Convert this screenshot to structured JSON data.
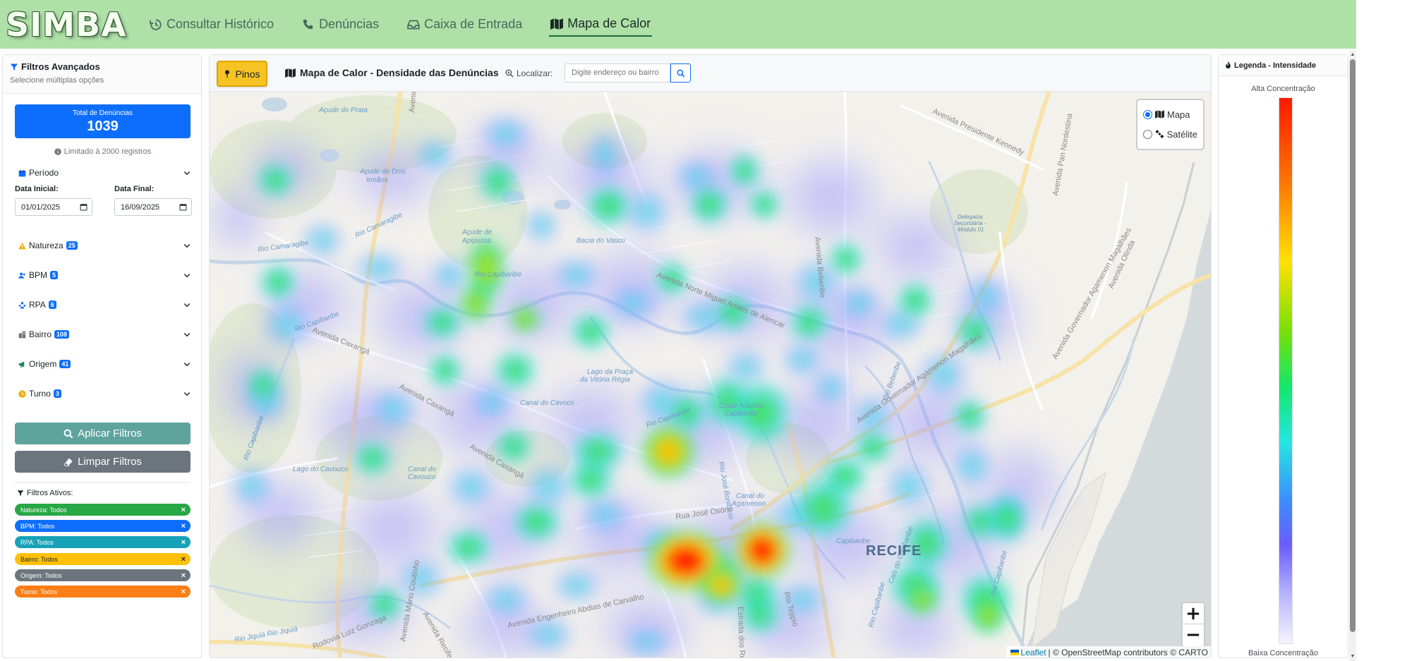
{
  "app": {
    "logo": "SIMBA"
  },
  "nav": {
    "items": [
      {
        "label": "Consultar Histórico",
        "icon": "history-icon"
      },
      {
        "label": "Denúncias",
        "icon": "phone-icon"
      },
      {
        "label": "Caixa de Entrada",
        "icon": "inbox-icon"
      },
      {
        "label": "Mapa de Calor",
        "icon": "map-icon",
        "active": true
      }
    ]
  },
  "sidebar": {
    "title": "Filtros Avançados",
    "subtitle": "Selecione múltiplas opções",
    "total_label": "Total de Denúncias",
    "total_value": "1039",
    "limit_note": "Limitado à 2000 registros",
    "period": {
      "label": "Período",
      "start_label": "Data Inicial:",
      "start_value": "01/01/2025",
      "end_label": "Data Final:",
      "end_value": "16/09/2025"
    },
    "filters": [
      {
        "label": "Natureza",
        "count": "25",
        "icon": "warning-icon",
        "icon_color": "#f0ad00"
      },
      {
        "label": "BPM",
        "count": "5",
        "icon": "users-icon",
        "icon_color": "#0d6efd"
      },
      {
        "label": "RPA",
        "count": "6",
        "icon": "region-icon",
        "icon_color": "#0d6efd"
      },
      {
        "label": "Bairro",
        "count": "108",
        "icon": "building-icon",
        "icon_color": "#6c757d"
      },
      {
        "label": "Origem",
        "count": "41",
        "icon": "megaphone-icon",
        "icon_color": "#198754"
      },
      {
        "label": "Turno",
        "count": "3",
        "icon": "clock-icon",
        "icon_color": "#f0ad00"
      }
    ],
    "apply_label": "Aplicar Filtros",
    "clear_label": "Limpar Filtros",
    "active_title": "Filtros Ativos:",
    "active_chips": [
      {
        "label": "Natureza: Todos",
        "color": "#28a745"
      },
      {
        "label": "BPM: Todos",
        "color": "#0d6efd"
      },
      {
        "label": "RPA: Todos",
        "color": "#17a2b8"
      },
      {
        "label": "Bairro: Todos",
        "color": "#ffc107"
      },
      {
        "label": "Origem: Todos",
        "color": "#6c757d"
      },
      {
        "label": "Turno: Todos",
        "color": "#fd7e14"
      }
    ]
  },
  "map": {
    "pins_label": "Pinos",
    "title": "Mapa de Calor - Densidade das Denúncias",
    "locate_label": "Localizar:",
    "search_placeholder": "Digite endereço ou bairro",
    "layers": [
      {
        "label": "Mapa",
        "selected": true
      },
      {
        "label": "Satélite",
        "selected": false
      }
    ],
    "zoom_in": "+",
    "zoom_out": "−",
    "attribution_leaflet": "Leaflet",
    "attribution_rest": "| © OpenStreetMap contributors © CARTO",
    "labels": {
      "city": "RECIFE",
      "acude_prata": "Açude do Prata",
      "acude_dois_irmaos": "Açude de Dois\nIrmãos",
      "acude_apipucos": "Açude de\nApipucos",
      "bacia_vasco": "Bacia do Vasco",
      "rio_camaragibe_1": "Rio Camaragibe",
      "rio_camaragibe_2": "Rio Camaragibe",
      "rio_capibaribe_1": "Rio Capibaribe",
      "rio_capibaribe_2": "Rio Capibaribe",
      "rio_capibaribe_3": "Rio Capibaribe",
      "rio_capibaribe_4": "Rio Capibaribe",
      "rio_jose_bonifacio": "Rio José Bonifácio",
      "rio_jiquia": "Rio Jiquiá Rio Jiquiá",
      "av_recuperacao": "Avenida da Recuperação",
      "av_norte": "Avenida Norte Miguel Arraes de Alencar",
      "av_caxanga_1": "Avenida Caxangá",
      "av_caxanga_2": "Avenida Caxangá",
      "av_caxanga_3": "Avenida Caxangá",
      "av_beberibe": "Avenida Beberibe",
      "av_kennedy": "Avenida Presidente Kennedy",
      "av_pan": "Avenida Pan Nordestina",
      "av_agamenon_1": "Avenida Governador Agamenon Magalhães",
      "av_agamenon_2": "Avenida Governador Agamenon Magalhães",
      "av_olinda": "Avenida Olinda",
      "av_abdias": "Avenida Engenheiro Abdias de Carvalho",
      "rua_jose_osorio": "Rua José Osório",
      "estrada_remedios": "Estrada dos Remédios",
      "av_recife": "Avenida Recife",
      "av_mario_coutinho": "Avenida Mário Coutinho",
      "rod_luiz_gonzaga": "Rodovia Luiz Gonzaga",
      "rio_tejipio": "Rio Tejipió",
      "rio_capibaribe_center": "Rio Capibaribe",
      "lago_praca": "Lago da Praça\nda Vitória Régia",
      "canal_cavoco": "Canal do Cavoco",
      "lago_cavouco": "Lago do Cavouco",
      "canal_cavouco": "Canal do\nCavouco",
      "clube_nautico": "Clube Náutico\nCapibaribe",
      "canal_agamenon": "Canal do\nAgamenon",
      "capibaribe_mouth": "Capibaribe",
      "rio_beberibe": "Rio Beberibe",
      "rio_capibaribe_east": "Rio Capibaribe",
      "rio_capibaribe_east2": "Rio Capibaribe",
      "cais_capibaribe": "Cais do Capibaribe",
      "delegacia": "Delegacia\nSecundária -\nMódulo 01"
    }
  },
  "legend": {
    "title": "Legenda - Intensidade",
    "high": "Alta Concentração",
    "low": "Baixa Concentração",
    "gradient": [
      "#ff1a00",
      "#ff7a00",
      "#ffe100",
      "#7fe000",
      "#12e86a",
      "#26e6e0",
      "#3d8cff",
      "#6a5cff",
      "#b8b4ff",
      "#f4f4ff"
    ]
  }
}
